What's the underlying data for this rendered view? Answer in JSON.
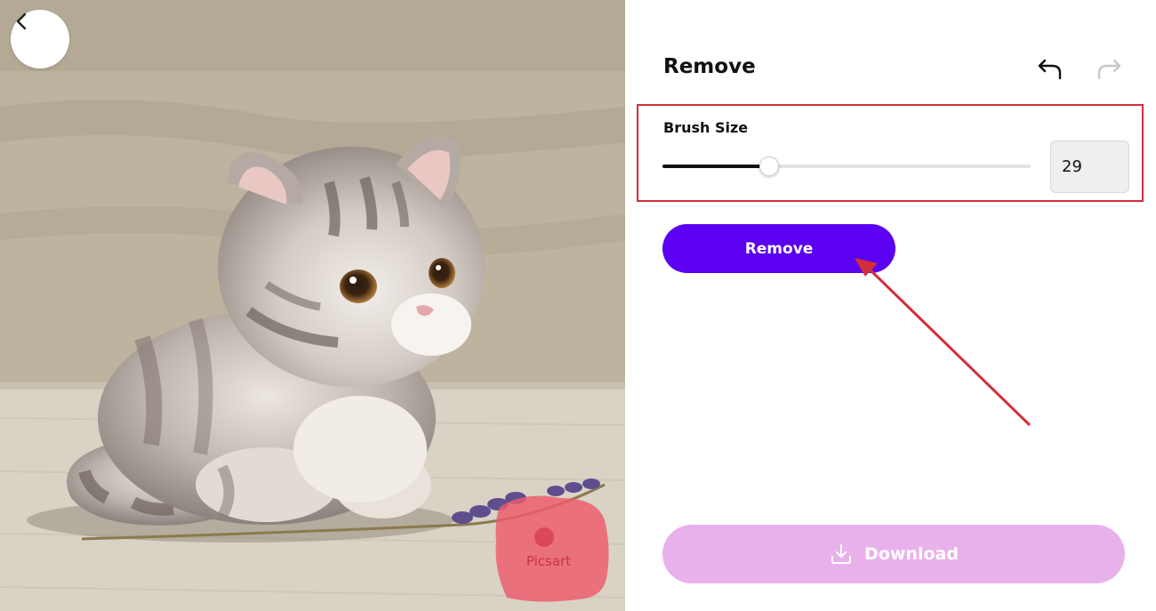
{
  "panel": {
    "title": "Remove",
    "brush_size_label": "Brush Size",
    "brush_size_value": "29",
    "brush_size_fraction": 0.29,
    "remove_button_label": "Remove",
    "download_button_label": "Download"
  },
  "canvas": {
    "watermark_text": "Picsart"
  },
  "colors": {
    "accent": "#5b00f0",
    "download_disabled": "#e9b1ec",
    "highlight": "#d32f3a"
  },
  "icons": {
    "back": "chevron-left-icon",
    "undo": "undo-icon",
    "redo": "redo-icon",
    "download": "download-icon"
  }
}
